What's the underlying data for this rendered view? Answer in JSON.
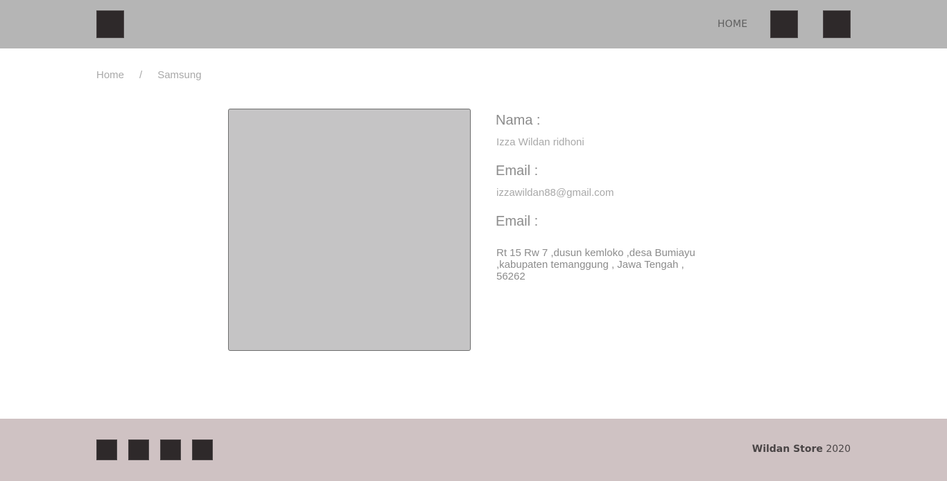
{
  "navbar": {
    "logo_icon": "logo-icon",
    "home_label": "HOME",
    "buttons": [
      "cart-icon",
      "user-icon"
    ]
  },
  "breadcrumb": {
    "home": "Home",
    "separator": "/",
    "current": "Samsung"
  },
  "profile": {
    "name_label": "Nama :",
    "name_value": "Izza Wildan ridhoni",
    "email_label": "Email :",
    "email_value": "izzawildan88@gmail.com",
    "address_label": "Email :",
    "address_value": "Rt 15 Rw 7 ,dusun kemloko ,desa Bumiayu ,kabupaten temanggung , Jawa Tengah , 56262"
  },
  "footer": {
    "social_icons": [
      "facebook-icon",
      "twitter-icon",
      "instagram-icon",
      "youtube-icon"
    ],
    "brand": "Wildan Store",
    "year": "2020"
  },
  "colors": {
    "navbar_bg": "#b5b5b5",
    "footer_bg": "#cfc2c3",
    "icon_square": "#2e292a",
    "photo_bg": "#c5c4c5"
  }
}
